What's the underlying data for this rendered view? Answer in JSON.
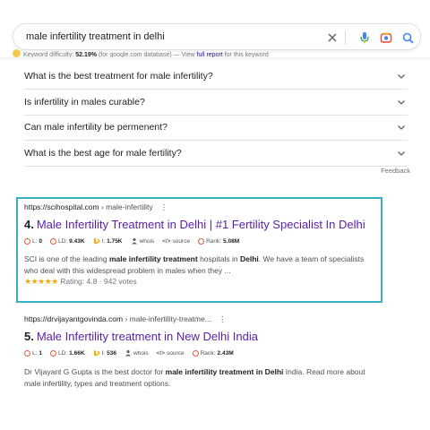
{
  "search": {
    "query": "male infertility treatment in delhi"
  },
  "keyword_bar": {
    "label": "Keyword difficulty:",
    "value": "52.19%",
    "source": "(for google.com database) — View",
    "link_text": "full report",
    "suffix": "for this keyword"
  },
  "faq": {
    "items": [
      {
        "label": "What is the best treatment for male infertility?"
      },
      {
        "label": "Is infertility in males curable?"
      },
      {
        "label": "Can male infertility be permenent?"
      },
      {
        "label": "What is the best age for male fertility?"
      }
    ],
    "feedback": "Feedback"
  },
  "results": [
    {
      "url_domain": "https://scihospital.com",
      "url_path": " › male-infertility",
      "number": "4.",
      "title": "Male Infertility Treatment in Delhi | #1 Fertility Specialist In Delhi",
      "metrics": {
        "l_label": "L:",
        "l_value": "0",
        "ld_label": "LD:",
        "ld_value": "9.43K",
        "i_label": "I:",
        "i_value": "1.75K",
        "whois": "whois",
        "source": "source",
        "rank_label": "Rank:",
        "rank_value": "5.08M"
      },
      "snippet_parts": [
        {
          "t": "SCI is one of the leading ",
          "b": false
        },
        {
          "t": "male infertility treatment",
          "b": true
        },
        {
          "t": " hospitals in ",
          "b": false
        },
        {
          "t": "Delhi",
          "b": true
        },
        {
          "t": ". We have a team of specialists who deal with this widespread problem in males when they ...",
          "b": false
        }
      ],
      "stars": "★★★★★",
      "rating_text": "Rating: 4.8 · 942 votes"
    },
    {
      "url_domain": "https://drvijayantgovinda.com",
      "url_path": " › male-infertility-treatme...",
      "number": "5.",
      "title": "Male Infertility treatment in New Delhi India",
      "metrics": {
        "l_label": "L:",
        "l_value": "1",
        "ld_label": "LD:",
        "ld_value": "1.66K",
        "i_label": "I:",
        "i_value": "536",
        "whois": "whois",
        "source": "source",
        "rank_label": "Rank:",
        "rank_value": "2.43M"
      },
      "snippet_parts": [
        {
          "t": "Dr Vijayant G Gupta is the best doctor for ",
          "b": false
        },
        {
          "t": "male infertility treatment in Delhi",
          "b": true
        },
        {
          "t": " India. Read more about male infertility, types and treatment options.",
          "b": false
        }
      ]
    }
  ],
  "colors": {
    "title_link": "#5a1ea8",
    "highlight_border": "#36b2c2",
    "star": "#f4a80b",
    "metric_circle": "#e25a3a"
  }
}
